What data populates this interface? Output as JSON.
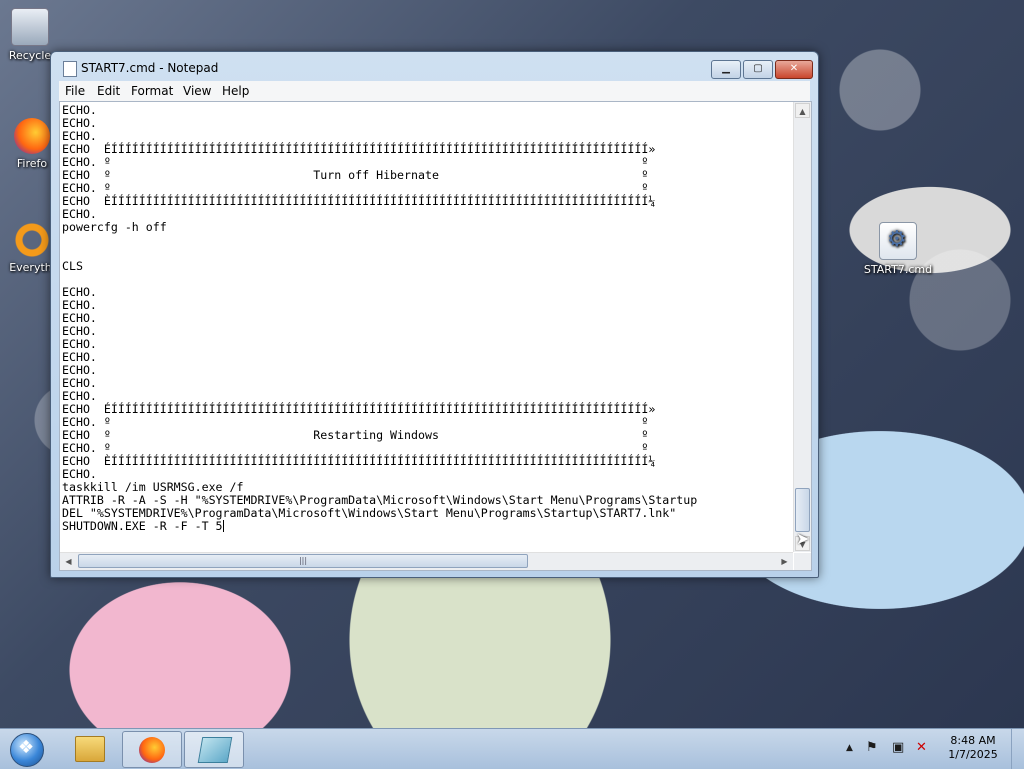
{
  "desktop": {
    "icons": [
      {
        "label": "Recycle",
        "icon": "recycle-bin-icon"
      },
      {
        "label": "Firefo",
        "icon": "firefox-icon"
      },
      {
        "label": "Everythi",
        "icon": "everything-icon"
      },
      {
        "label": "START7.cmd",
        "icon": "cmd-file-icon"
      }
    ]
  },
  "window": {
    "title": "START7.cmd - Notepad",
    "controls": {
      "minimize": "▁",
      "maximize": "▢",
      "close": "✕"
    },
    "menu": [
      "File",
      "Edit",
      "Format",
      "View",
      "Help"
    ]
  },
  "editor": {
    "lines": [
      "ECHO.",
      "ECHO.",
      "ECHO.",
      "ECHO  ÉÍÍÍÍÍÍÍÍÍÍÍÍÍÍÍÍÍÍÍÍÍÍÍÍÍÍÍÍÍÍÍÍÍÍÍÍÍÍÍÍÍÍÍÍÍÍÍÍÍÍÍÍÍÍÍÍÍÍÍÍÍÍÍÍÍÍÍÍÍÍÍÍÍÍÍÍÍ»",
      "ECHO. º                                                                            º",
      "ECHO  º                             Turn off Hibernate                             º",
      "ECHO. º                                                                            º",
      "ECHO  ÈÍÍÍÍÍÍÍÍÍÍÍÍÍÍÍÍÍÍÍÍÍÍÍÍÍÍÍÍÍÍÍÍÍÍÍÍÍÍÍÍÍÍÍÍÍÍÍÍÍÍÍÍÍÍÍÍÍÍÍÍÍÍÍÍÍÍÍÍÍÍÍÍÍÍÍÍÍ¼",
      "ECHO.",
      "powercfg -h off",
      "",
      "",
      "CLS",
      "",
      "ECHO.",
      "ECHO.",
      "ECHO.",
      "ECHO.",
      "ECHO.",
      "ECHO.",
      "ECHO.",
      "ECHO.",
      "ECHO.",
      "ECHO  ÉÍÍÍÍÍÍÍÍÍÍÍÍÍÍÍÍÍÍÍÍÍÍÍÍÍÍÍÍÍÍÍÍÍÍÍÍÍÍÍÍÍÍÍÍÍÍÍÍÍÍÍÍÍÍÍÍÍÍÍÍÍÍÍÍÍÍÍÍÍÍÍÍÍÍÍÍÍ»",
      "ECHO. º                                                                            º",
      "ECHO  º                             Restarting Windows                             º",
      "ECHO. º                                                                            º",
      "ECHO  ÈÍÍÍÍÍÍÍÍÍÍÍÍÍÍÍÍÍÍÍÍÍÍÍÍÍÍÍÍÍÍÍÍÍÍÍÍÍÍÍÍÍÍÍÍÍÍÍÍÍÍÍÍÍÍÍÍÍÍÍÍÍÍÍÍÍÍÍÍÍÍÍÍÍÍÍÍÍ¼",
      "ECHO.",
      "taskkill /im USRMSG.exe /f",
      "ATTRIB -R -A -S -H \"%SYSTEMDRIVE%\\ProgramData\\Microsoft\\Windows\\Start Menu\\Programs\\Startup",
      "DEL \"%SYSTEMDRIVE%\\ProgramData\\Microsoft\\Windows\\Start Menu\\Programs\\Startup\\START7.lnk\"",
      "SHUTDOWN.EXE -R -F -T 5"
    ],
    "scroll": {
      "vertical_position": 0.96,
      "horizontal_position": 0.0
    }
  },
  "taskbar": {
    "apps": [
      {
        "name": "Windows Explorer",
        "icon": "folder-icon"
      },
      {
        "name": "Firefox",
        "icon": "firefox-icon"
      },
      {
        "name": "Notepad",
        "icon": "notepad-icon"
      }
    ],
    "tray": {
      "icons": [
        "show-hidden-icon",
        "flag-icon",
        "network-icon",
        "volume-muted-icon"
      ]
    },
    "clock": {
      "time": "8:48 AM",
      "date": "1/7/2025"
    }
  }
}
